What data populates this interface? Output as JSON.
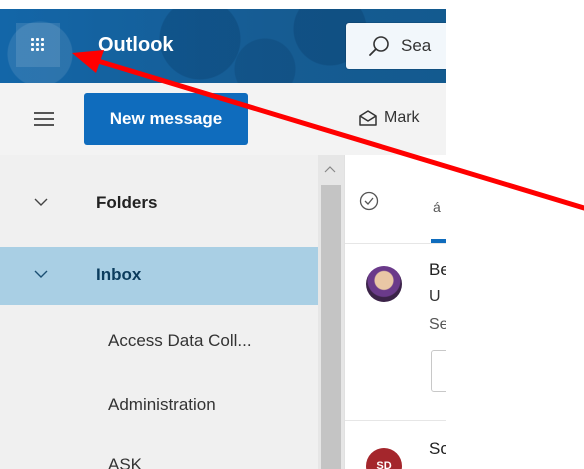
{
  "header": {
    "app_name": "Outlook",
    "search_placeholder": "Sea",
    "icons": [
      "app-launcher-icon",
      "search-icon"
    ],
    "brand_color": "#0f6cbd"
  },
  "toolbar": {
    "new_message_label": "New message",
    "mark_label": "Mark",
    "icons": [
      "hamburger-icon",
      "mark-read-envelope-icon"
    ]
  },
  "sidebar": {
    "folders_label": "Folders",
    "inbox_label": "Inbox",
    "subfolders": [
      "Access Data Coll...",
      "Administration",
      "ASK"
    ],
    "selected_color": "#a9cfe4"
  },
  "message_list": {
    "tab_glyph": "á",
    "messages": [
      {
        "sender": "Be",
        "subject": "U",
        "preview": "Se"
      },
      {
        "avatar_initials": "SD",
        "sender": "Sc"
      }
    ]
  },
  "annotation": {
    "arrow_color": "#ff0000",
    "target": "app-launcher-button"
  }
}
